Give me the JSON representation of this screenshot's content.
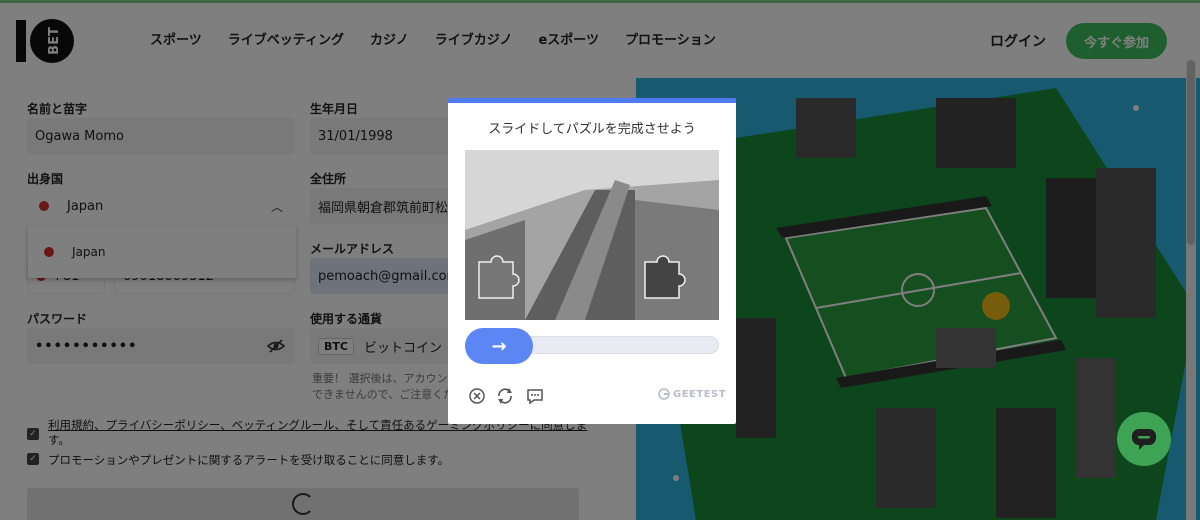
{
  "header": {
    "logo_text": "10 BET",
    "nav": [
      "スポーツ",
      "ライブベッティング",
      "カジノ",
      "ライブカジノ",
      "eスポーツ",
      "プロモーション"
    ],
    "login_label": "ログイン",
    "join_label": "今すぐ参加",
    "accent_color": "#3fbf5f"
  },
  "form": {
    "name_label": "名前と苗字",
    "name_value": "Ogawa Momo",
    "dob_label": "生年月日",
    "dob_value": "31/01/1998",
    "country_label": "出身国",
    "country_value": "Japan",
    "country_option": "Japan",
    "address_label": "全住所",
    "address_value": "福岡県朝倉郡筑前町松",
    "email_label": "メールアドレス",
    "email_value": "pemoach@gmail.com",
    "phone_code": "+81",
    "phone_value": "09018009312",
    "password_label": "パスワード",
    "password_value": "•••••••••••",
    "currency_label": "使用する通貨",
    "currency_tag": "BTC",
    "currency_value": "ビットコイン",
    "currency_note_1": "重要！ 選択後は、アカウン",
    "currency_note_2": "できませんので、ご注意くだ",
    "terms_text": "利用規約、プライバシーポリシー、ベッティングルール、そして責任あるゲーミングポリシーに同意しま",
    "terms_text_2": "す。",
    "promo_text": "プロモーションやプレゼントに関するアラートを受け取ることに同意します。"
  },
  "captcha": {
    "title": "スライドしてパズルを完成させよう",
    "slider_arrow": "→",
    "brand": "GEETEST",
    "icons": [
      "close-icon",
      "refresh-icon",
      "feedback-icon"
    ]
  },
  "chat": {
    "icon": "chat-icon"
  }
}
